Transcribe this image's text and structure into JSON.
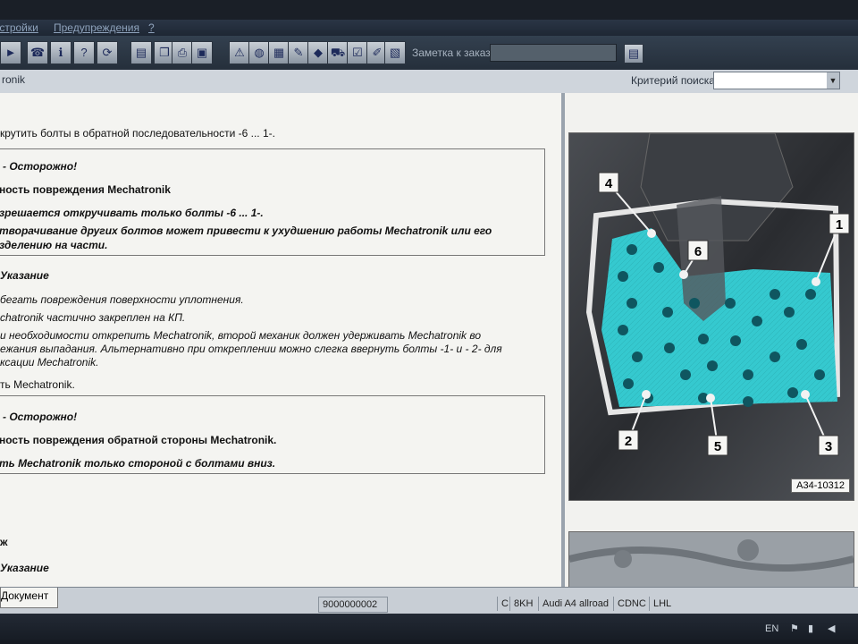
{
  "menubar": {
    "items": [
      "Настройки",
      "Предупреждения",
      "?"
    ]
  },
  "toolbar": {
    "note_label": "Заметка к заказу:",
    "note_value": "",
    "buttons": [
      {
        "icon": "play-icon",
        "glyph": "►"
      },
      {
        "icon": "phone-icon",
        "glyph": "☎"
      },
      {
        "icon": "info-icon",
        "glyph": "ℹ"
      },
      {
        "icon": "help-icon",
        "glyph": "?"
      },
      {
        "icon": "refresh-icon",
        "glyph": "⟳"
      },
      {
        "icon": "document-icon",
        "glyph": "▤"
      },
      {
        "icon": "copy-icon",
        "glyph": "❐"
      },
      {
        "icon": "print-icon",
        "glyph": "⎙"
      },
      {
        "icon": "book-icon",
        "glyph": "▣"
      },
      {
        "icon": "warning-icon",
        "glyph": "⚠"
      },
      {
        "icon": "globe-icon",
        "glyph": "◍"
      },
      {
        "icon": "save-icon",
        "glyph": "▦"
      },
      {
        "icon": "pen-icon",
        "glyph": "✎"
      },
      {
        "icon": "car-icon",
        "glyph": "◆"
      },
      {
        "icon": "vehicle-icon",
        "glyph": "⛟"
      },
      {
        "icon": "checklist-icon",
        "glyph": "☑"
      },
      {
        "icon": "edit-icon",
        "glyph": "✐"
      },
      {
        "icon": "clipboard-icon",
        "glyph": "▧"
      }
    ]
  },
  "addressbar": {
    "title": "ronik",
    "search_label": "Критерий поиска:",
    "search_value": ""
  },
  "document": {
    "intro": "крутить болты в обратной последовательности -6 ... 1-.",
    "caution1": {
      "heading": "Осторожно!",
      "line1": "ность повреждения Mechatronik",
      "line2": "зрешается откручивать только болты -6 ... 1-.",
      "line3": "творачивание других болтов может привести к ухудшению работы Mechatronik или его",
      "line4": "зделению на части."
    },
    "note1": {
      "heading": "Указание",
      "lines": [
        "бегать повреждения поверхности уплотнения.",
        "chatronik частично закреплен на КП.",
        "и необходимости открепить Mechatronik, второй механик должен удерживать Mechatronik во",
        "ежания выпадания. Альтернативно при откреплении можно слегка ввернуть болты -1- и - 2- для",
        "ксации Mechatronik."
      ]
    },
    "step": "ть Mechatronik.",
    "caution2": {
      "heading": "Осторожно!",
      "line1": "ность повреждения обратной стороны Mechatronik.",
      "line2": "ть Mechatronik только стороной с болтами вниз."
    },
    "tail1": "ж",
    "tail2": "Указание"
  },
  "figure": {
    "callouts": [
      "1",
      "2",
      "3",
      "4",
      "5",
      "6"
    ],
    "caption": "A34-10312",
    "colors": {
      "plate": "#35c9cf",
      "bolt": "#0f5660",
      "gasket": "#e6e6e6"
    }
  },
  "statusbar": {
    "tab": "Документ",
    "doc_id": "9000000002",
    "cells": [
      "C",
      "8KH",
      "Audi A4 allroad",
      "CDNC",
      "LHL"
    ]
  },
  "taskbar": {
    "lang": "EN"
  }
}
